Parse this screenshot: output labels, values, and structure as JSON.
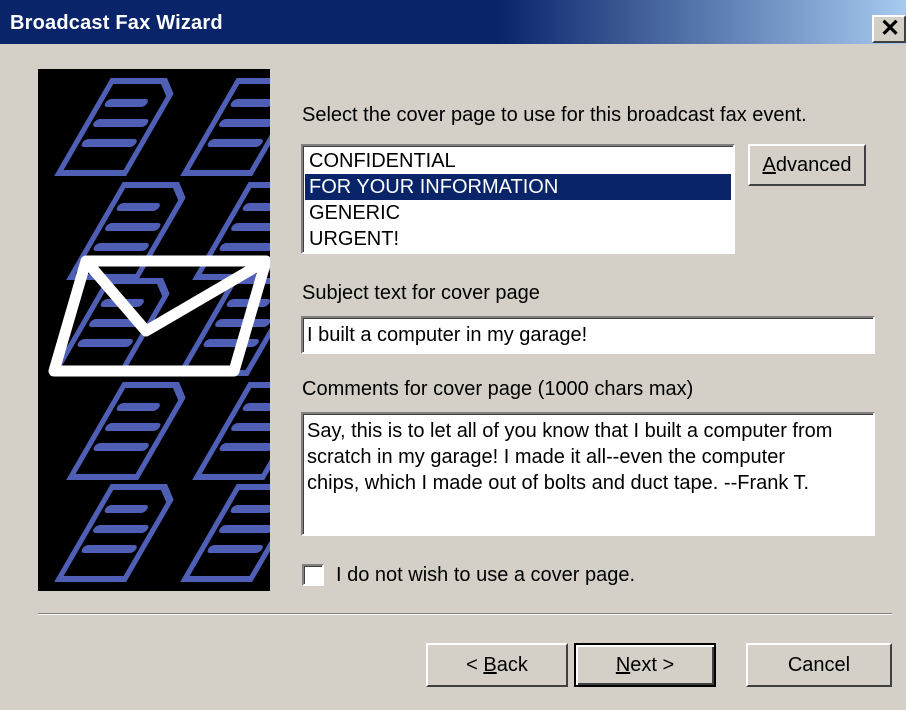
{
  "window": {
    "title": "Broadcast Fax Wizard",
    "close_glyph": "✕"
  },
  "cover_page": {
    "prompt": "Select the cover page to use for this broadcast fax event.",
    "options": [
      "CONFIDENTIAL",
      "FOR YOUR INFORMATION",
      "GENERIC",
      "URGENT!"
    ],
    "selected_index": 1,
    "advanced_button": {
      "prefix": "",
      "accel": "A",
      "rest": "dvanced"
    }
  },
  "subject": {
    "label": "Subject text for cover page",
    "value": "I built a computer in my garage!"
  },
  "comments": {
    "label": "Comments for cover page (1000 chars max)",
    "lines": [
      "Say, this is to let all of you know that I built a computer from",
      "scratch in my garage! I made it all--even the computer",
      "chips, which I made out of bolts and duct tape. --Frank T."
    ]
  },
  "no_cover": {
    "label": "I do not wish to use a cover page.",
    "checked": false
  },
  "footer": {
    "back": {
      "prefix": "< ",
      "accel": "B",
      "rest": "ack"
    },
    "next": {
      "prefix": "",
      "accel": "N",
      "rest": "ext >"
    },
    "cancel": "Cancel"
  },
  "colors": {
    "title_bar": "#0a246a",
    "selection": "#0a246a",
    "art_doc": "#4f5fb5",
    "dialog_face": "#d4d0c8"
  },
  "icons": {
    "sidebar": "fax-documents-and-envelope-graphic",
    "close": "close-icon"
  }
}
